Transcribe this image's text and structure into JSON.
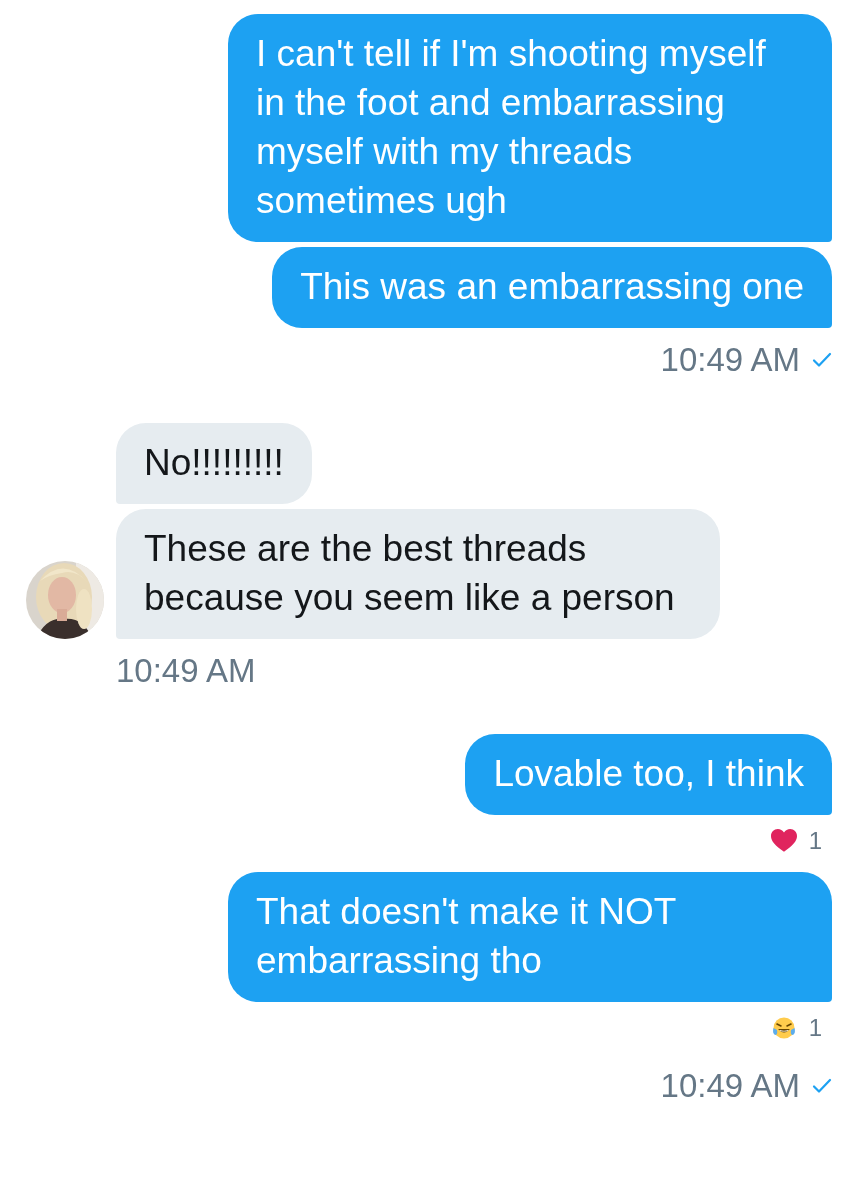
{
  "groups": [
    {
      "kind": "sent",
      "read": true,
      "time": "10:49 AM",
      "messages": [
        {
          "text": "I can't tell if I'm shooting myself in the foot and embarrassing myself with my threads sometimes ugh"
        },
        {
          "text": "This was an embarrassing one"
        }
      ]
    },
    {
      "kind": "received",
      "avatar": {
        "kind": "picture"
      },
      "time": "10:49 AM",
      "messages": [
        {
          "text": "No!!!!!!!!!"
        },
        {
          "text": "These are the best threads because you seem like a person"
        }
      ]
    },
    {
      "kind": "sent",
      "read": true,
      "time": "10:49 AM",
      "messages": [
        {
          "text": "Lovable too, I think",
          "reaction": {
            "kind": "heart",
            "count": "1"
          }
        },
        {
          "text": "That doesn't make it NOT embarrassing tho",
          "reaction": {
            "kind": "laughing",
            "count": "1"
          }
        }
      ]
    }
  ]
}
